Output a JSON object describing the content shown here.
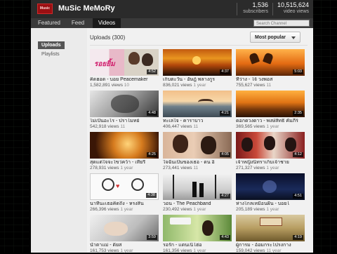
{
  "channel": {
    "name": "MuSic MeMoRy",
    "logo_text": "Music"
  },
  "stats": [
    {
      "number": "1,536",
      "label": "subscribers"
    },
    {
      "number": "10,515,624",
      "label": "video views"
    }
  ],
  "tabs": [
    "Featured",
    "Feed",
    "Videos"
  ],
  "active_tab": "Videos",
  "search": {
    "placeholder": "Search Channel"
  },
  "sidebar": {
    "items": [
      "Uploads",
      "Playlists"
    ],
    "selected": "Uploads"
  },
  "uploads": {
    "heading": "Uploads (300)",
    "sort_label": "Most popular"
  },
  "colors": {
    "header": "#2b2b2b",
    "accent": "#9a0f12",
    "selected_sidebar": "#555555"
  },
  "videos": [
    {
      "title": "คิดฮอด - บอย Peacemaker",
      "views": "1,582,891 views",
      "ago": "10",
      "duration": "4:52"
    },
    {
      "title": "เก็บตะวัน - อัษฎ์ พลางกูร",
      "views": "836,021 views",
      "ago": "1 year",
      "duration": "4:37"
    },
    {
      "title": "ที่ว่าง - โจ้ วงพอส",
      "views": "755,627 views",
      "ago": "11",
      "duration": "5:03"
    },
    {
      "title": "ไม่เป็นอะไร - ปราโมทย์",
      "views": "542,918 views",
      "ago": "11",
      "duration": "4:48"
    },
    {
      "title": "ทะเลใจ - คาราบาว",
      "views": "406,447 views",
      "ago": "11",
      "duration": "4:21"
    },
    {
      "title": "ดอกดวงดาว - พงษ์สิทธิ์ คัมภีร์",
      "views": "369,565 views",
      "ago": "1 year",
      "duration": "2:35"
    },
    {
      "title": "สุดแต่ใจจะไขว่คว้า - เทียรี่",
      "views": "278,931 views",
      "ago": "1 year",
      "duration": "4:25"
    },
    {
      "title": "ใจฉันเป็นของเธอ - ดน อิ",
      "views": "273,441 views",
      "ago": "11",
      "duration": "4:05"
    },
    {
      "title": "เจ้าหญิงนิทราเก็บเจ้าชาย",
      "views": "271,327 views",
      "ago": "1 year",
      "duration": "4:12"
    },
    {
      "title": "นาทีนะเธอคิดถึง - หรงสิน",
      "views": "266,396 views",
      "ago": "1 year",
      "duration": "4:38"
    },
    {
      "title": "วอน - The Peachband",
      "views": "230,492 views",
      "ago": "1 year",
      "duration": "4:27"
    },
    {
      "title": "ห่างไกลเหมือนฝัน - บอยโ",
      "views": "205,189 views",
      "ago": "1 year",
      "duration": "4:51"
    },
    {
      "title": "น้ำตาแม่ - ดิ่ยส",
      "views": "161,753 views",
      "ago": "1 year",
      "duration": "3:59"
    },
    {
      "title": "รอรัก - แดนเนิโฮ่อ",
      "views": "161,356 views",
      "ago": "1 year",
      "duration": "4:43"
    },
    {
      "title": "ผู้การม - อ้อมกระโปรงกาง",
      "views": "159,042 views",
      "ago": "11 year",
      "duration": "4:19"
    }
  ]
}
